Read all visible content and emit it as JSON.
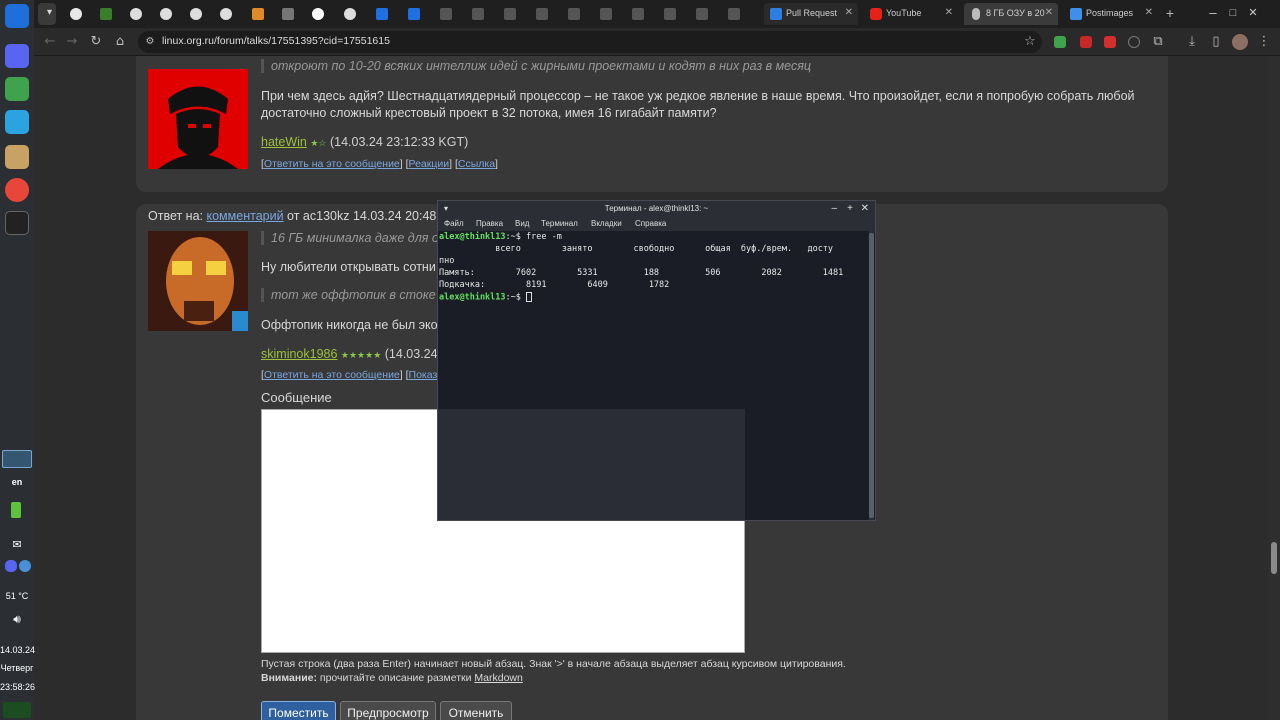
{
  "browser": {
    "url": "linux.org.ru/forum/talks/17551395?cid=17551615",
    "tabs": [
      {
        "label": "Pull Request"
      },
      {
        "label": "YouTube"
      },
      {
        "label": "8 ГБ ОЗУ в 20"
      },
      {
        "label": "Postimages"
      }
    ]
  },
  "dock": {
    "lang": "en",
    "temp": "51 °C",
    "date": "14.03.24",
    "weekday": "Четверг",
    "time": "23:58:26"
  },
  "post1": {
    "quote": "откроют по 10-20 всяких интеллиж идей с жирными проектами и кодят в них раз в месяц",
    "body_line1": "При чем здесь адйя? Шестнадцатиядерный процессор – не такое уж редкое явление в наше время. Что произойдет, если я попробую собрать любой",
    "body_line2": "достаточно сложный крестовый проект в 32 потока, имея 16 гигабайт памяти?",
    "author": "hateWin",
    "stars": "★☆",
    "timestamp": "(14.03.24 23:12:33 KGT)",
    "link_reply": "Ответить на это сообщение",
    "link_react": "Реакции",
    "link_link": "Ссылка"
  },
  "post2": {
    "reply_prefix": "Ответ на:",
    "reply_link": "комментарий",
    "reply_suffix": "от ac130kz 14.03.24 20:48:4",
    "quote1": "16 ГБ минималка даже для о",
    "body1": "Ну любители открывать сотни в",
    "quote2": "тот же оффтопик в стоке с",
    "body2": "Оффтопик никогда не был эконо",
    "author": "skiminok1986",
    "stars": "★★★★★",
    "timestamp": "(14.03.24",
    "link_reply": "Ответить на это сообщение",
    "link_show": "Показать"
  },
  "editor": {
    "label": "Сообщение",
    "hint": "Пустая строка (два раза Enter) начинает новый абзац. Знак '>' в начале абзаца выделяет абзац курсивом цитирования.",
    "warn_bold": "Внимание:",
    "warn_text": "прочитайте описание разметки",
    "warn_link": "Markdown",
    "btn_post": "Поместить",
    "btn_preview": "Предпросмотр",
    "btn_cancel": "Отменить"
  },
  "terminal": {
    "title": "Терминал - alex@thinkl13: ~",
    "menu": [
      "Файл",
      "Правка",
      "Вид",
      "Терминал",
      "Вкладки",
      "Справка"
    ],
    "prompt": "alex@thinkl13",
    "cmd": ":~$ free -m",
    "header": "           всего        занято        свободно      общая  буф./врем.   досту",
    "header2": "пно",
    "mem": "Память:        7602        5331         188         506        2082        1481",
    "swap": "Подкачка:        8191        6409        1782",
    "prompt2_suffix": ":~$ "
  }
}
